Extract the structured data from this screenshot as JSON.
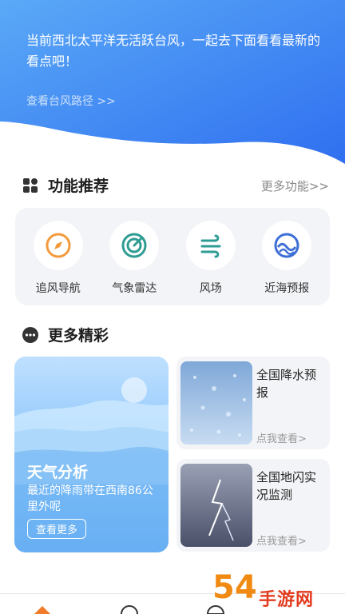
{
  "hero": {
    "message": "当前西北太平洋无活跃台风，一起去下面看看最新的看点吧！",
    "route_link": "查看台风路径 >>"
  },
  "features": {
    "title": "功能推荐",
    "more": "更多功能>>",
    "items": [
      {
        "label": "追风导航",
        "icon": "compass-icon"
      },
      {
        "label": "气象雷达",
        "icon": "radar-icon"
      },
      {
        "label": "风场",
        "icon": "wind-icon"
      },
      {
        "label": "近海预报",
        "icon": "sea-wave-icon"
      }
    ]
  },
  "highlights": {
    "title": "更多精彩",
    "weather_card": {
      "title": "天气分析",
      "desc": "最近的降雨带在西南86公里外呢",
      "button": "查看更多"
    },
    "cards": [
      {
        "title": "全国降水预报",
        "link": "点我查看>"
      },
      {
        "title": "全国地闪实况监测",
        "link": "点我查看>"
      }
    ]
  },
  "watermark": {
    "number": "54",
    "text": "手游网"
  },
  "colors": {
    "accent": "#3d7ff2",
    "orange": "#f29a3c",
    "teal": "#2f9c94"
  }
}
